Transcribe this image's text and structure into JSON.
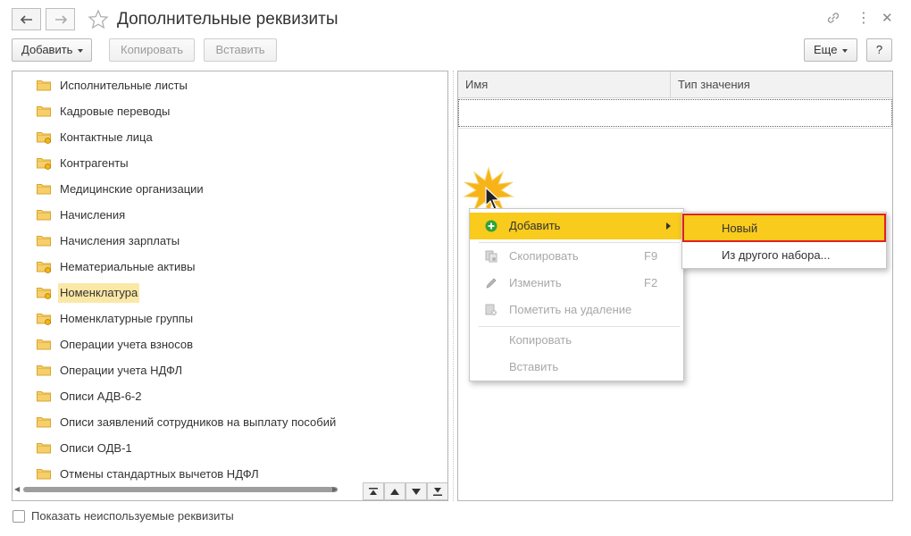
{
  "window": {
    "title": "Дополнительные реквизиты"
  },
  "toolbar": {
    "add_label": "Добавить",
    "copy_label": "Копировать",
    "paste_label": "Вставить",
    "more_label": "Еще",
    "help_label": "?"
  },
  "tree": {
    "items": [
      {
        "label": "Исполнительные листы",
        "folder": "plain"
      },
      {
        "label": "Кадровые переводы",
        "folder": "plain"
      },
      {
        "label": "Контактные лица",
        "folder": "badge"
      },
      {
        "label": "Контрагенты",
        "folder": "badge"
      },
      {
        "label": "Медицинские организации",
        "folder": "plain"
      },
      {
        "label": "Начисления",
        "folder": "plain"
      },
      {
        "label": "Начисления зарплаты",
        "folder": "plain"
      },
      {
        "label": "Нематериальные активы",
        "folder": "badge"
      },
      {
        "label": "Номенклатура",
        "folder": "badge",
        "selected": true
      },
      {
        "label": "Номенклатурные группы",
        "folder": "badge"
      },
      {
        "label": "Операции учета взносов",
        "folder": "plain"
      },
      {
        "label": "Операции учета НДФЛ",
        "folder": "plain"
      },
      {
        "label": "Описи АДВ-6-2",
        "folder": "plain"
      },
      {
        "label": "Описи заявлений сотрудников на выплату пособий",
        "folder": "plain"
      },
      {
        "label": "Описи ОДВ-1",
        "folder": "plain"
      },
      {
        "label": "Отмены стандартных вычетов НДФЛ",
        "folder": "plain"
      }
    ]
  },
  "grid": {
    "col_name": "Имя",
    "col_type": "Тип значения"
  },
  "context_menu": {
    "items": [
      {
        "label": "Добавить",
        "icon": "plus-circle-icon",
        "shortcut": "",
        "state": "highlighted",
        "has_submenu": true
      },
      {
        "label": "Скопировать",
        "icon": "copy-icon",
        "shortcut": "F9",
        "state": "disabled"
      },
      {
        "label": "Изменить",
        "icon": "pencil-icon",
        "shortcut": "F2",
        "state": "disabled"
      },
      {
        "label": "Пометить на удаление",
        "icon": "mark-delete-icon",
        "shortcut": "",
        "state": "disabled"
      },
      {
        "label": "Копировать",
        "icon": "",
        "shortcut": "",
        "state": "disabled"
      },
      {
        "label": "Вставить",
        "icon": "",
        "shortcut": "",
        "state": "disabled"
      }
    ]
  },
  "submenu": {
    "new_label": "Новый",
    "from_other_label": "Из другого набора..."
  },
  "footer": {
    "show_unused_label": "Показать неиспользуемые реквизиты"
  },
  "colors": {
    "highlight": "#f9cb1c",
    "selected_row": "#fbe8a6",
    "accent_outline": "#e02020"
  }
}
